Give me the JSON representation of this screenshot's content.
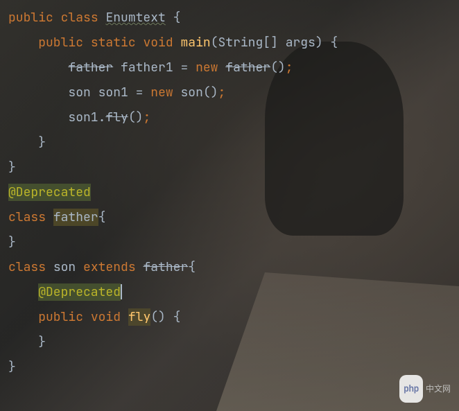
{
  "code": {
    "line1": {
      "kw_public": "public",
      "kw_class": "class",
      "classname": "Enumtext",
      "brace": "{"
    },
    "line2": {
      "kw_public": "public",
      "kw_static": "static",
      "kw_void": "void",
      "method": "main",
      "param_type": "String[]",
      "param_name": "args",
      "brace": "{"
    },
    "line3": {
      "type": "father",
      "varname": "father1",
      "eq": "=",
      "kw_new": "new",
      "ctor": "father",
      "parens": "()",
      "semi": ";"
    },
    "line4": {
      "type": "son",
      "varname": "son1",
      "eq": "=",
      "kw_new": "new",
      "ctor": "son",
      "parens": "()",
      "semi": ";"
    },
    "line5": {
      "obj": "son1",
      "dot": ".",
      "method": "fly",
      "parens": "()",
      "semi": ";"
    },
    "line6": {
      "brace": "}"
    },
    "line7": {
      "brace": "}"
    },
    "line8": {
      "annotation": "@Deprecated"
    },
    "line9": {
      "kw_class": "class",
      "classname": "father",
      "brace": "{"
    },
    "line10": {
      "brace": "}"
    },
    "line11": {
      "kw_class": "class",
      "classname": "son",
      "kw_extends": "extends",
      "superclass": "father",
      "brace": "{"
    },
    "line12": {
      "annotation": "@Deprecated"
    },
    "line13": {
      "kw_public": "public",
      "kw_void": "void",
      "method": "fly",
      "parens": "()",
      "brace": "{"
    },
    "line14": {
      "brace": "}"
    },
    "line15": {
      "brace": "}"
    }
  },
  "watermark": {
    "logo": "php",
    "text": "中文网"
  }
}
